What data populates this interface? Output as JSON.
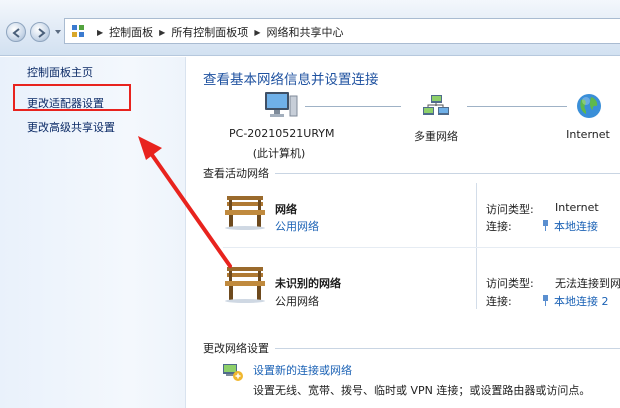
{
  "breadcrumbs": [
    "控制面板",
    "所有控制面板项",
    "网络和共享中心"
  ],
  "sidebar": {
    "items": [
      {
        "label": "控制面板主页"
      },
      {
        "label": "更改适配器设置"
      },
      {
        "label": "更改高级共享设置"
      }
    ]
  },
  "main": {
    "title": "查看基本网络信息并设置连接",
    "map": {
      "computer_name": "PC-20210521URYM",
      "computer_sub": "(此计算机)",
      "middle": "多重网络",
      "internet": "Internet"
    },
    "active_section_title": "查看活动网络",
    "networks": [
      {
        "name": "网络",
        "type": "公用网络",
        "type_is_link": true,
        "access_label": "访问类型:",
        "access_value": "Internet",
        "conn_label": "连接:",
        "conn_value": "本地连接"
      },
      {
        "name": "未识别的网络",
        "type": "公用网络",
        "type_is_link": false,
        "access_label": "访问类型:",
        "access_value": "无法连接到网",
        "conn_label": "连接:",
        "conn_value": "本地连接 2"
      }
    ],
    "change_section_title": "更改网络设置",
    "setup": {
      "link": "设置新的连接或网络",
      "desc": "设置无线、宽带、拨号、临时或 VPN 连接；或设置路由器或访问点。"
    }
  },
  "colors": {
    "link": "#1b62b5",
    "title": "#1f52a0",
    "highlight_box": "#e8231e"
  }
}
